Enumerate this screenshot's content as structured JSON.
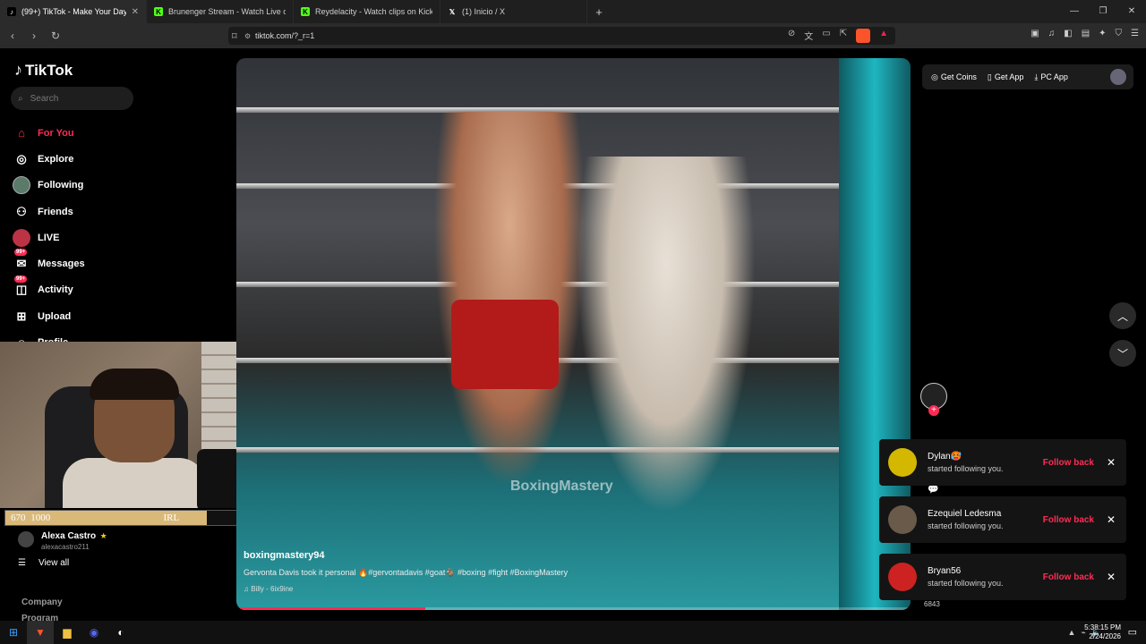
{
  "browser": {
    "tabs": [
      {
        "title": "(99+) TikTok - Make Your Day",
        "active": true,
        "icon": "tiktok-icon"
      },
      {
        "title": "Brunenger Stream - Watch Live on Kick",
        "active": false,
        "icon": "kick-icon"
      },
      {
        "title": "Reydelacity - Watch clips on Kick",
        "active": false,
        "icon": "kick-icon"
      },
      {
        "title": "(1) Inicio / X",
        "active": false,
        "icon": "x-icon"
      }
    ],
    "url": "tiktok.com/?_r=1"
  },
  "sidebar": {
    "logo": "TikTok",
    "search_placeholder": "Search",
    "nav": [
      {
        "label": "For You",
        "icon": "home-icon",
        "active": true
      },
      {
        "label": "Explore",
        "icon": "compass-icon"
      },
      {
        "label": "Following",
        "icon": "following-avatar-icon"
      },
      {
        "label": "Friends",
        "icon": "friends-icon"
      },
      {
        "label": "LIVE",
        "icon": "live-icon"
      },
      {
        "label": "Messages",
        "icon": "messages-icon",
        "badge": "99+"
      },
      {
        "label": "Activity",
        "icon": "activity-icon",
        "badge": "99+"
      },
      {
        "label": "Upload",
        "icon": "upload-icon"
      },
      {
        "label": "Profile",
        "icon": "profile-icon"
      }
    ],
    "goal": {
      "left": "670",
      "middle": "IRL",
      "right": "1000",
      "progress": 0.67
    },
    "account": {
      "name": "Alexa Castro",
      "handle": "alexacastro211"
    },
    "view_all": "View all",
    "footer": [
      "Company",
      "Program"
    ]
  },
  "video": {
    "watermark": "BoxingMastery",
    "username": "boxingmastery94",
    "description": "Gervonta Davis took it personal 🔥#gervontadavis #goat🐐 #boxing #fight #BoxingMastery",
    "sound": "♫ Billy - 6ix9ine",
    "progress": 0.28
  },
  "topbar": {
    "get_coins": "Get Coins",
    "get_app": "Get App",
    "pc_app": "PC App"
  },
  "side_count": "6843",
  "notifications": [
    {
      "name": "Dylan🥵",
      "text": "started following you.",
      "action": "Follow back",
      "color": "#d4b800"
    },
    {
      "name": "Ezequiel Ledesma",
      "text": "started following you.",
      "action": "Follow back",
      "color": "#6a5a4a"
    },
    {
      "name": "Bryan56",
      "text": "started following you.",
      "action": "Follow back",
      "color": "#c22"
    }
  ],
  "taskbar": {
    "time": "5:38:15 PM",
    "date": "2/24/2026"
  },
  "colors": {
    "accent": "#fe2c55"
  }
}
